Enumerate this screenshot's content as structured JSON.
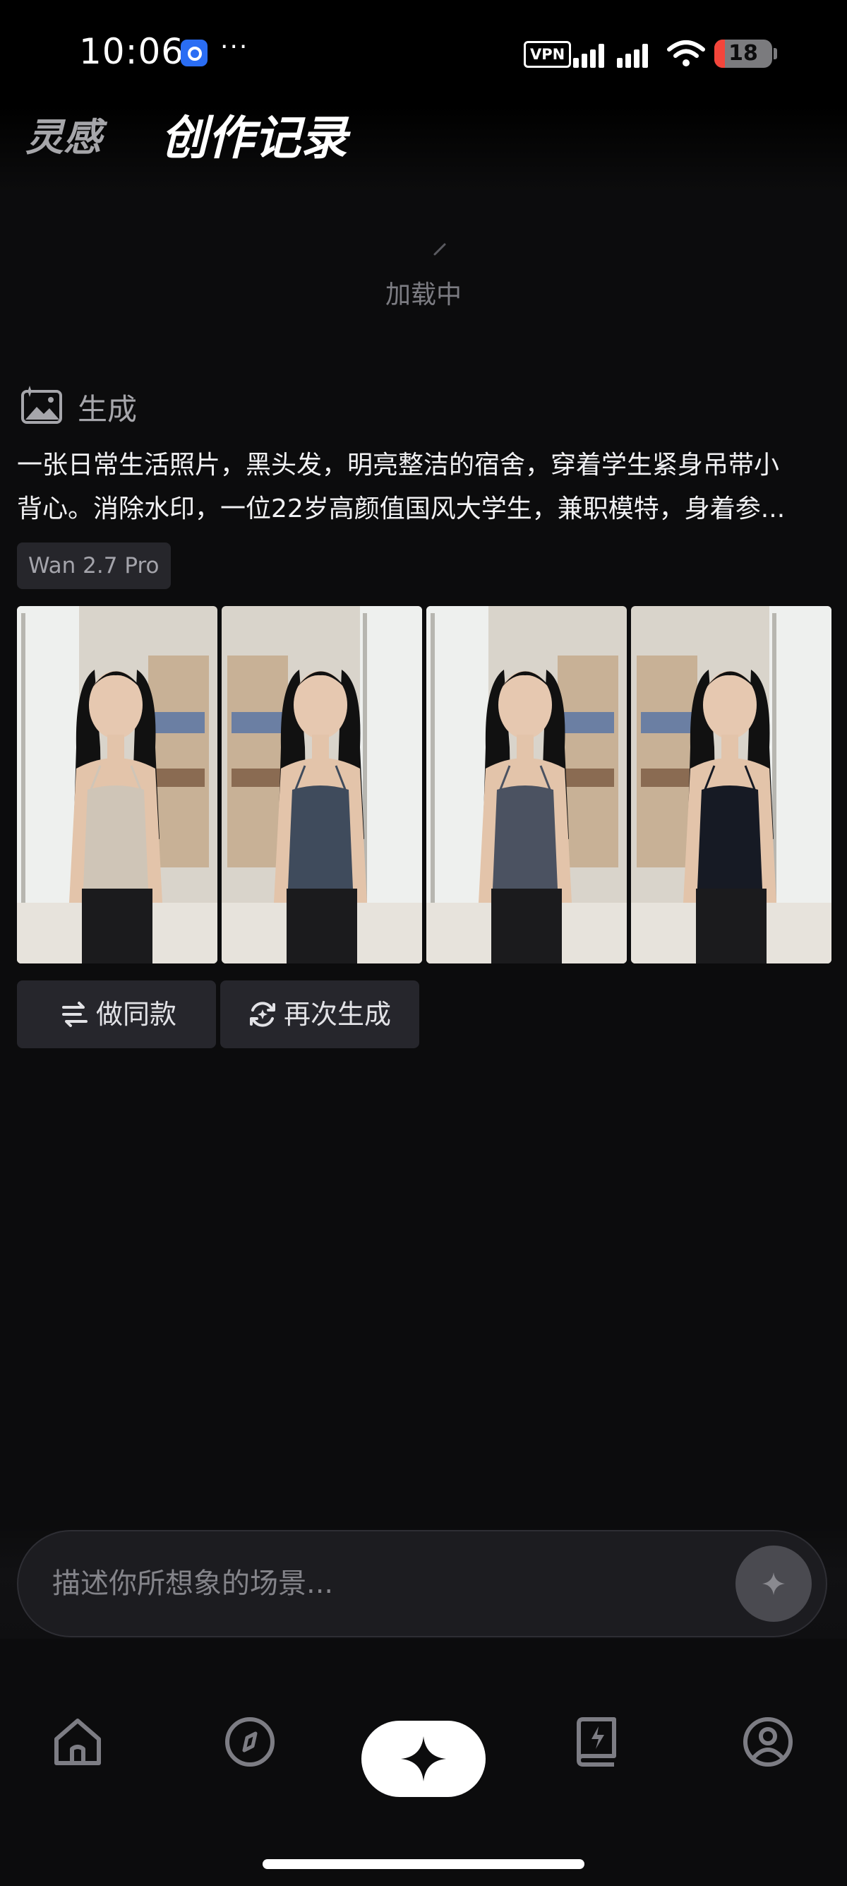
{
  "status_bar": {
    "time": "10:06",
    "more_indicator": "···",
    "vpn_label": "VPN",
    "battery_level": "18",
    "icons": [
      "app-notification-icon",
      "signal-icon",
      "wifi-icon",
      "battery-icon"
    ]
  },
  "header": {
    "tab_inspiration": "灵感",
    "tab_records": "创作记录"
  },
  "loading": {
    "text": "加载中"
  },
  "record": {
    "type_label": "生成",
    "type_icon": "image-sparkle-icon",
    "prompt_line1": "一张日常生活照片，黑头发，明亮整洁的宿舍，穿着学生紧身吊带小",
    "prompt_line2": "背心。消除水印，一位22岁高颜值国风大学生，兼职模特，身着参...",
    "model": "Wan 2.7 Pro",
    "image_count": 4,
    "images": [
      {
        "top_color": "#cfc5b7",
        "top_label": "beige-tank-top"
      },
      {
        "top_color": "#3f4b5c",
        "top_label": "slate-tank-top"
      },
      {
        "top_color": "#4b5261",
        "top_label": "gray-tank-top"
      },
      {
        "top_color": "#161a24",
        "top_label": "navy-tank-top"
      }
    ],
    "actions": {
      "make_same": "做同款",
      "make_same_icon": "swap-icon",
      "regenerate": "再次生成",
      "regenerate_icon": "refresh-sparkle-icon"
    }
  },
  "input": {
    "placeholder": "描述你所想象的场景...",
    "send_icon": "sparkle-icon"
  },
  "bottom_nav": {
    "items": [
      {
        "name": "home",
        "icon": "home-icon"
      },
      {
        "name": "discover",
        "icon": "compass-icon"
      },
      {
        "name": "create",
        "icon": "sparkle-icon",
        "active": true
      },
      {
        "name": "library",
        "icon": "book-bolt-icon"
      },
      {
        "name": "profile",
        "icon": "user-icon"
      }
    ]
  }
}
